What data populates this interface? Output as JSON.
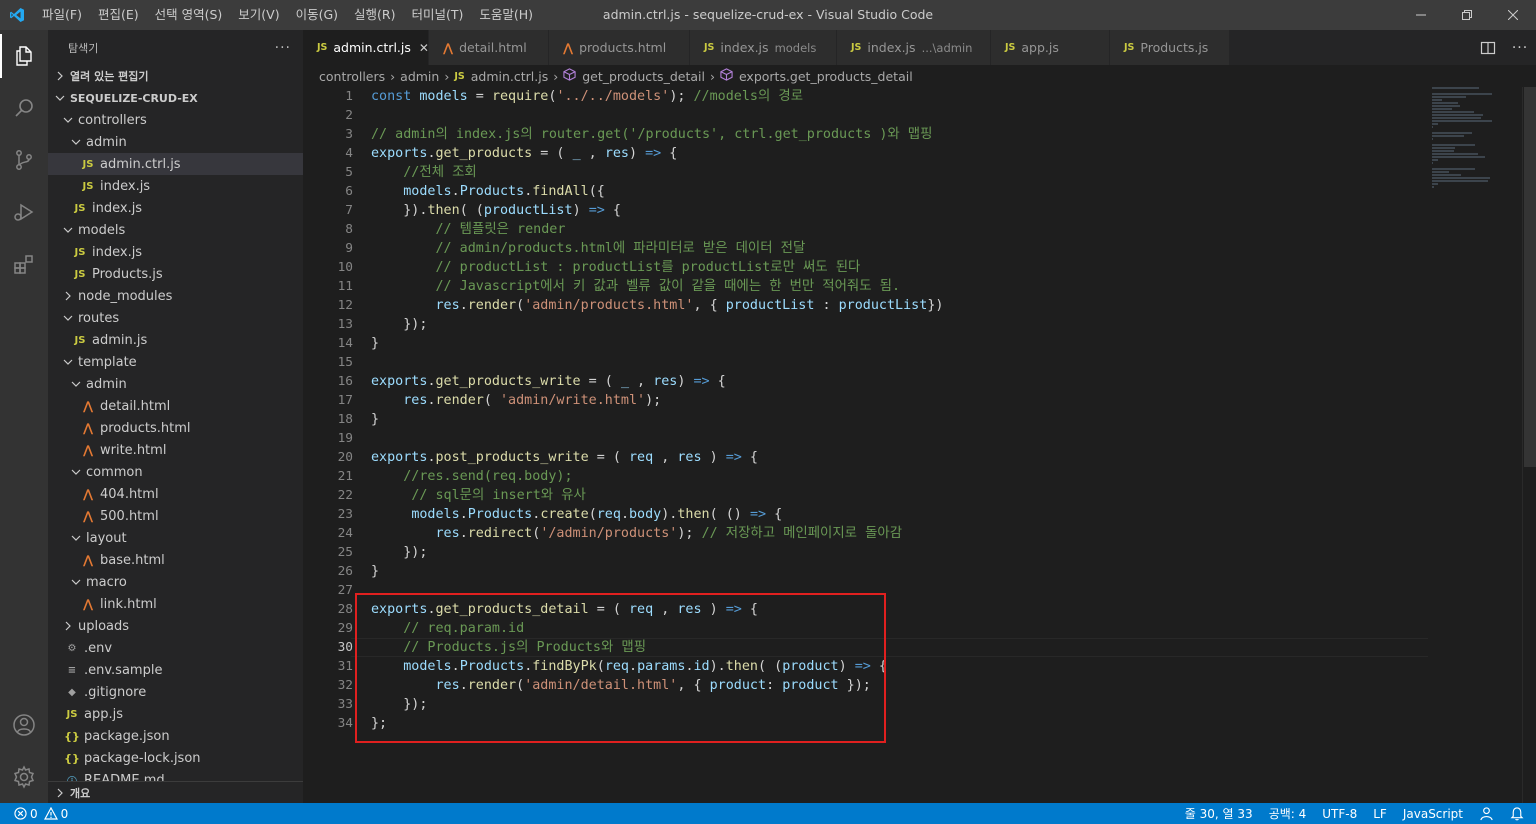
{
  "titlebar": {
    "menu": [
      "파일(F)",
      "편집(E)",
      "선택 영역(S)",
      "보기(V)",
      "이동(G)",
      "실행(R)",
      "터미널(T)",
      "도움말(H)"
    ],
    "window_title": "admin.ctrl.js - sequelize-crud-ex - Visual Studio Code"
  },
  "sidebar": {
    "header": "탐색기",
    "more": "···",
    "open_editors": "열려 있는 편집기",
    "project": "SEQUELIZE-CRUD-EX",
    "tree": [
      {
        "label": "controllers",
        "kind": "folder-open",
        "depth": 1
      },
      {
        "label": "admin",
        "kind": "folder-open",
        "depth": 2
      },
      {
        "label": "admin.ctrl.js",
        "kind": "js",
        "depth": 3,
        "selected": true
      },
      {
        "label": "index.js",
        "kind": "js",
        "depth": 3
      },
      {
        "label": "index.js",
        "kind": "js",
        "depth": 2
      },
      {
        "label": "models",
        "kind": "folder-open",
        "depth": 1
      },
      {
        "label": "index.js",
        "kind": "js",
        "depth": 2
      },
      {
        "label": "Products.js",
        "kind": "js",
        "depth": 2
      },
      {
        "label": "node_modules",
        "kind": "folder-closed",
        "depth": 1
      },
      {
        "label": "routes",
        "kind": "folder-open",
        "depth": 1
      },
      {
        "label": "admin.js",
        "kind": "js",
        "depth": 2
      },
      {
        "label": "template",
        "kind": "folder-open",
        "depth": 1
      },
      {
        "label": "admin",
        "kind": "folder-open",
        "depth": 2
      },
      {
        "label": "detail.html",
        "kind": "html",
        "depth": 3
      },
      {
        "label": "products.html",
        "kind": "html",
        "depth": 3
      },
      {
        "label": "write.html",
        "kind": "html",
        "depth": 3
      },
      {
        "label": "common",
        "kind": "folder-open",
        "depth": 2
      },
      {
        "label": "404.html",
        "kind": "html",
        "depth": 3
      },
      {
        "label": "500.html",
        "kind": "html",
        "depth": 3
      },
      {
        "label": "layout",
        "kind": "folder-open",
        "depth": 2
      },
      {
        "label": "base.html",
        "kind": "html",
        "depth": 3
      },
      {
        "label": "macro",
        "kind": "folder-open",
        "depth": 2
      },
      {
        "label": "link.html",
        "kind": "html",
        "depth": 3
      },
      {
        "label": "uploads",
        "kind": "folder-closed",
        "depth": 1
      },
      {
        "label": ".env",
        "kind": "gear",
        "depth": 1
      },
      {
        "label": ".env.sample",
        "kind": "plain",
        "depth": 1
      },
      {
        "label": ".gitignore",
        "kind": "git",
        "depth": 1
      },
      {
        "label": "app.js",
        "kind": "js",
        "depth": 1
      },
      {
        "label": "package.json",
        "kind": "json",
        "depth": 1
      },
      {
        "label": "package-lock.json",
        "kind": "json",
        "depth": 1
      },
      {
        "label": "README.md",
        "kind": "info",
        "depth": 1
      }
    ],
    "outline": "개요"
  },
  "tabs": [
    {
      "label": "admin.ctrl.js",
      "icon": "JS",
      "type": "js",
      "active": true,
      "desc": ""
    },
    {
      "label": "detail.html",
      "icon": "html",
      "type": "html",
      "active": false,
      "desc": ""
    },
    {
      "label": "products.html",
      "icon": "html",
      "type": "html",
      "active": false,
      "desc": ""
    },
    {
      "label": "index.js",
      "icon": "JS",
      "type": "js",
      "active": false,
      "desc": "models"
    },
    {
      "label": "index.js",
      "icon": "JS",
      "type": "js",
      "active": false,
      "desc": "...\\admin"
    },
    {
      "label": "app.js",
      "icon": "JS",
      "type": "js",
      "active": false,
      "desc": ""
    },
    {
      "label": "Products.js",
      "icon": "JS",
      "type": "js",
      "active": false,
      "desc": ""
    }
  ],
  "tab_actions": {
    "more": "···"
  },
  "breadcrumb": {
    "parts": [
      "controllers",
      "admin",
      "admin.ctrl.js",
      "get_products_detail",
      "exports.get_products_detail"
    ]
  },
  "editor": {
    "current_line": 30,
    "lines": [
      [
        [
          "k",
          "const "
        ],
        [
          "v",
          "models"
        ],
        [
          "o",
          " = "
        ],
        [
          "f",
          "require"
        ],
        [
          "o",
          "("
        ],
        [
          "s",
          "'../../models'"
        ],
        [
          "o",
          "); "
        ],
        [
          "c",
          "//models의 경로"
        ]
      ],
      [],
      [
        [
          "c",
          "// admin의 index.js의 router.get('/products', ctrl.get_products )와 맵핑"
        ]
      ],
      [
        [
          "v",
          "exports"
        ],
        [
          "o",
          "."
        ],
        [
          "f",
          "get_products"
        ],
        [
          "o",
          " = ( "
        ],
        [
          "v",
          "_"
        ],
        [
          "o",
          " , "
        ],
        [
          "v",
          "res"
        ],
        [
          "o",
          ") "
        ],
        [
          "k",
          "=>"
        ],
        [
          "o",
          " {"
        ]
      ],
      [
        [
          "o",
          "    "
        ],
        [
          "c",
          "//전체 조회"
        ]
      ],
      [
        [
          "o",
          "    "
        ],
        [
          "v",
          "models"
        ],
        [
          "o",
          "."
        ],
        [
          "v",
          "Products"
        ],
        [
          "o",
          "."
        ],
        [
          "f",
          "findAll"
        ],
        [
          "o",
          "({"
        ]
      ],
      [
        [
          "o",
          "    })."
        ],
        [
          "f",
          "then"
        ],
        [
          "o",
          "( ("
        ],
        [
          "v",
          "productList"
        ],
        [
          "o",
          ") "
        ],
        [
          "k",
          "=>"
        ],
        [
          "o",
          " {"
        ]
      ],
      [
        [
          "o",
          "        "
        ],
        [
          "c",
          "// 템플릿은 render"
        ]
      ],
      [
        [
          "o",
          "        "
        ],
        [
          "c",
          "// admin/products.html에 파라미터로 받은 데이터 전달"
        ]
      ],
      [
        [
          "o",
          "        "
        ],
        [
          "c",
          "// productList : productList를 productList로만 써도 된다"
        ]
      ],
      [
        [
          "o",
          "        "
        ],
        [
          "c",
          "// Javascript에서 키 값과 벨류 값이 같을 때에는 한 번만 적어줘도 됨."
        ]
      ],
      [
        [
          "o",
          "        "
        ],
        [
          "v",
          "res"
        ],
        [
          "o",
          "."
        ],
        [
          "f",
          "render"
        ],
        [
          "o",
          "("
        ],
        [
          "s",
          "'admin/products.html'"
        ],
        [
          "o",
          ", { "
        ],
        [
          "v",
          "productList"
        ],
        [
          "o",
          " : "
        ],
        [
          "v",
          "productList"
        ],
        [
          "o",
          "})"
        ]
      ],
      [
        [
          "o",
          "    });"
        ]
      ],
      [
        [
          "o",
          "}"
        ]
      ],
      [],
      [
        [
          "v",
          "exports"
        ],
        [
          "o",
          "."
        ],
        [
          "f",
          "get_products_write"
        ],
        [
          "o",
          " = ( "
        ],
        [
          "v",
          "_"
        ],
        [
          "o",
          " , "
        ],
        [
          "v",
          "res"
        ],
        [
          "o",
          ") "
        ],
        [
          "k",
          "=>"
        ],
        [
          "o",
          " {"
        ]
      ],
      [
        [
          "o",
          "    "
        ],
        [
          "v",
          "res"
        ],
        [
          "o",
          "."
        ],
        [
          "f",
          "render"
        ],
        [
          "o",
          "( "
        ],
        [
          "s",
          "'admin/write.html'"
        ],
        [
          "o",
          ");"
        ]
      ],
      [
        [
          "o",
          "}"
        ]
      ],
      [],
      [
        [
          "v",
          "exports"
        ],
        [
          "o",
          "."
        ],
        [
          "f",
          "post_products_write"
        ],
        [
          "o",
          " = ( "
        ],
        [
          "v",
          "req"
        ],
        [
          "o",
          " , "
        ],
        [
          "v",
          "res"
        ],
        [
          "o",
          " ) "
        ],
        [
          "k",
          "=>"
        ],
        [
          "o",
          " {"
        ]
      ],
      [
        [
          "o",
          "    "
        ],
        [
          "c",
          "//res.send(req.body);"
        ]
      ],
      [
        [
          "o",
          "     "
        ],
        [
          "c",
          "// sql문의 insert와 유사"
        ]
      ],
      [
        [
          "o",
          "     "
        ],
        [
          "v",
          "models"
        ],
        [
          "o",
          "."
        ],
        [
          "v",
          "Products"
        ],
        [
          "o",
          "."
        ],
        [
          "f",
          "create"
        ],
        [
          "o",
          "("
        ],
        [
          "v",
          "req"
        ],
        [
          "o",
          "."
        ],
        [
          "v",
          "body"
        ],
        [
          "o",
          ")."
        ],
        [
          "f",
          "then"
        ],
        [
          "o",
          "( () "
        ],
        [
          "k",
          "=>"
        ],
        [
          "o",
          " {"
        ]
      ],
      [
        [
          "o",
          "        "
        ],
        [
          "v",
          "res"
        ],
        [
          "o",
          "."
        ],
        [
          "f",
          "redirect"
        ],
        [
          "o",
          "("
        ],
        [
          "s",
          "'/admin/products'"
        ],
        [
          "o",
          "); "
        ],
        [
          "c",
          "// 저장하고 메인페이지로 돌아감"
        ]
      ],
      [
        [
          "o",
          "    });"
        ]
      ],
      [
        [
          "o",
          "}"
        ]
      ],
      [],
      [
        [
          "v",
          "exports"
        ],
        [
          "o",
          "."
        ],
        [
          "f",
          "get_products_detail"
        ],
        [
          "o",
          " = ( "
        ],
        [
          "v",
          "req"
        ],
        [
          "o",
          " , "
        ],
        [
          "v",
          "res"
        ],
        [
          "o",
          " ) "
        ],
        [
          "k",
          "=>"
        ],
        [
          "o",
          " {"
        ]
      ],
      [
        [
          "o",
          "    "
        ],
        [
          "c",
          "// req.param.id"
        ]
      ],
      [
        [
          "o",
          "    "
        ],
        [
          "c",
          "// Products.js의 Products와 맵핑"
        ]
      ],
      [
        [
          "o",
          "    "
        ],
        [
          "v",
          "models"
        ],
        [
          "o",
          "."
        ],
        [
          "v",
          "Products"
        ],
        [
          "o",
          "."
        ],
        [
          "f",
          "findByPk"
        ],
        [
          "o",
          "("
        ],
        [
          "v",
          "req"
        ],
        [
          "o",
          "."
        ],
        [
          "v",
          "params"
        ],
        [
          "o",
          "."
        ],
        [
          "v",
          "id"
        ],
        [
          "o",
          ")."
        ],
        [
          "f",
          "then"
        ],
        [
          "o",
          "( ("
        ],
        [
          "v",
          "product"
        ],
        [
          "o",
          ") "
        ],
        [
          "k",
          "=>"
        ],
        [
          "o",
          " {"
        ]
      ],
      [
        [
          "o",
          "        "
        ],
        [
          "v",
          "res"
        ],
        [
          "o",
          "."
        ],
        [
          "f",
          "render"
        ],
        [
          "o",
          "("
        ],
        [
          "s",
          "'admin/detail.html'"
        ],
        [
          "o",
          ", { "
        ],
        [
          "v",
          "product"
        ],
        [
          "o",
          ": "
        ],
        [
          "v",
          "product"
        ],
        [
          "o",
          " });"
        ]
      ],
      [
        [
          "o",
          "    });"
        ]
      ],
      [
        [
          "o",
          "};"
        ]
      ]
    ]
  },
  "statusbar": {
    "errors": "0",
    "warnings": "0",
    "position": "줄 30, 열 33",
    "indent": "공백: 4",
    "encoding": "UTF-8",
    "eol": "LF",
    "language": "JavaScript"
  },
  "colors": {
    "accent": "#007acc",
    "highlight_box": "#e0201f"
  }
}
